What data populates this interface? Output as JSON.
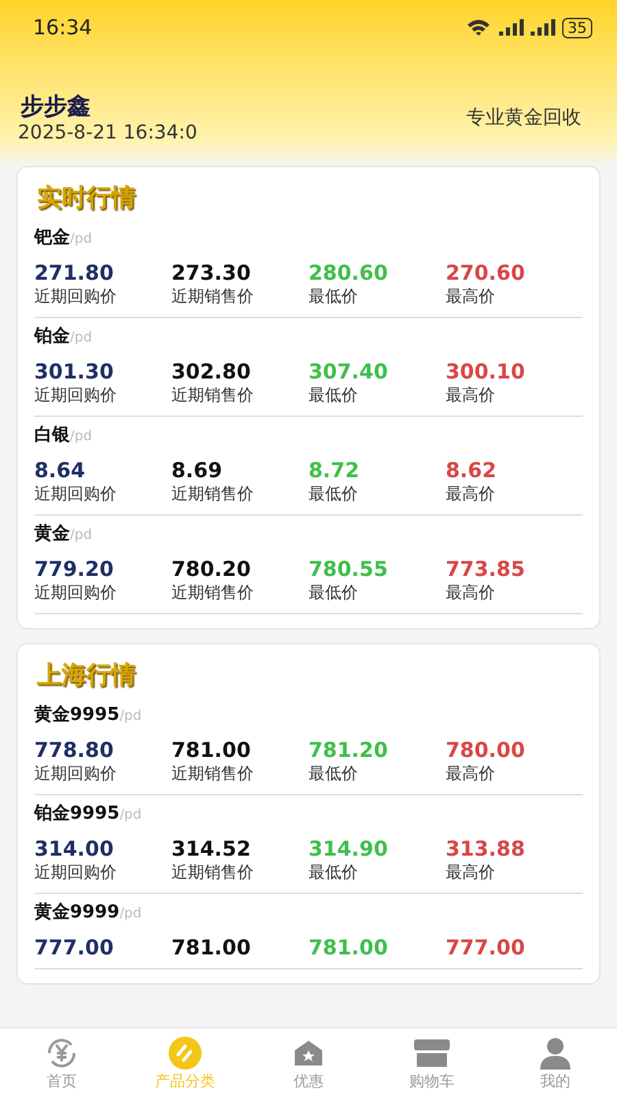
{
  "status_bar": {
    "time": "16:34",
    "battery": "35"
  },
  "header": {
    "brand": "步步鑫",
    "datetime": "2025-8-21 16:34:0",
    "slogan": "专业黄金回收"
  },
  "sections": [
    {
      "title": "实时行情",
      "items": [
        {
          "name": "钯金",
          "unit": "/pd",
          "prices": [
            {
              "kind": "buy",
              "value": "271.80",
              "label": "近期回购价"
            },
            {
              "kind": "sell",
              "value": "273.30",
              "label": "近期销售价"
            },
            {
              "kind": "low",
              "value": "280.60",
              "label": "最低价"
            },
            {
              "kind": "high",
              "value": "270.60",
              "label": "最高价"
            }
          ]
        },
        {
          "name": "铂金",
          "unit": "/pd",
          "prices": [
            {
              "kind": "buy",
              "value": "301.30",
              "label": "近期回购价"
            },
            {
              "kind": "sell",
              "value": "302.80",
              "label": "近期销售价"
            },
            {
              "kind": "low",
              "value": "307.40",
              "label": "最低价"
            },
            {
              "kind": "high",
              "value": "300.10",
              "label": "最高价"
            }
          ]
        },
        {
          "name": "白银",
          "unit": "/pd",
          "prices": [
            {
              "kind": "buy",
              "value": "8.64",
              "label": "近期回购价"
            },
            {
              "kind": "sell",
              "value": "8.69",
              "label": "近期销售价"
            },
            {
              "kind": "low",
              "value": "8.72",
              "label": "最低价"
            },
            {
              "kind": "high",
              "value": "8.62",
              "label": "最高价"
            }
          ]
        },
        {
          "name": "黄金",
          "unit": "/pd",
          "prices": [
            {
              "kind": "buy",
              "value": "779.20",
              "label": "近期回购价"
            },
            {
              "kind": "sell",
              "value": "780.20",
              "label": "近期销售价"
            },
            {
              "kind": "low",
              "value": "780.55",
              "label": "最低价"
            },
            {
              "kind": "high",
              "value": "773.85",
              "label": "最高价"
            }
          ]
        }
      ]
    },
    {
      "title": "上海行情",
      "items": [
        {
          "name": "黄金9995",
          "unit": "/pd",
          "prices": [
            {
              "kind": "buy",
              "value": "778.80",
              "label": "近期回购价"
            },
            {
              "kind": "sell",
              "value": "781.00",
              "label": "近期销售价"
            },
            {
              "kind": "low",
              "value": "781.20",
              "label": "最低价"
            },
            {
              "kind": "high",
              "value": "780.00",
              "label": "最高价"
            }
          ]
        },
        {
          "name": "铂金9995",
          "unit": "/pd",
          "prices": [
            {
              "kind": "buy",
              "value": "314.00",
              "label": "近期回购价"
            },
            {
              "kind": "sell",
              "value": "314.52",
              "label": "近期销售价"
            },
            {
              "kind": "low",
              "value": "314.90",
              "label": "最低价"
            },
            {
              "kind": "high",
              "value": "313.88",
              "label": "最高价"
            }
          ]
        },
        {
          "name": "黄金9999",
          "unit": "/pd",
          "prices": [
            {
              "kind": "buy",
              "value": "777.00"
            },
            {
              "kind": "sell",
              "value": "781.00"
            },
            {
              "kind": "low",
              "value": "781.00"
            },
            {
              "kind": "high",
              "value": "777.00"
            }
          ]
        }
      ]
    }
  ],
  "tab_bar": [
    {
      "kind": "home",
      "label": "首页",
      "selected": false
    },
    {
      "kind": "category",
      "label": "产品分类",
      "selected": true
    },
    {
      "kind": "offers",
      "label": "优惠",
      "selected": false
    },
    {
      "kind": "cart",
      "label": "购物车",
      "selected": false
    },
    {
      "kind": "mine",
      "label": "我的",
      "selected": false
    }
  ]
}
